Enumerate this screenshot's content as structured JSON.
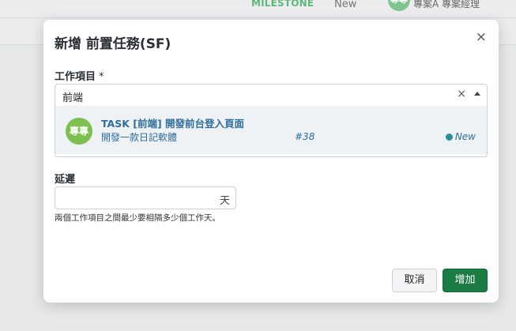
{
  "background": {
    "milestone_label": "MILESTONE",
    "status_label": "New",
    "avatar_text": "專專",
    "user_text": "專案A 專案經理"
  },
  "modal": {
    "title": "新增 前置任務(SF)",
    "close_glyph": "×",
    "work_item": {
      "label": "工作項目",
      "required_mark": "*",
      "search_value": "前端",
      "clear_glyph": "×",
      "options": [
        {
          "avatar_text": "專專",
          "title": "TASK [前端] 開發前台登入頁面",
          "subtitle": "開發一款日記軟體",
          "number": "#38",
          "status": "New",
          "status_color": "#2a8f9a"
        }
      ]
    },
    "delay": {
      "label": "延遲",
      "value": "",
      "unit": "天",
      "hint": "兩個工作項目之間最少要相隔多少個工作天。"
    },
    "buttons": {
      "cancel": "取消",
      "add": "增加"
    }
  },
  "colors": {
    "accent_green": "#1a7b43",
    "link_blue": "#2f6d9c",
    "avatar_green": "#7dc04f"
  }
}
